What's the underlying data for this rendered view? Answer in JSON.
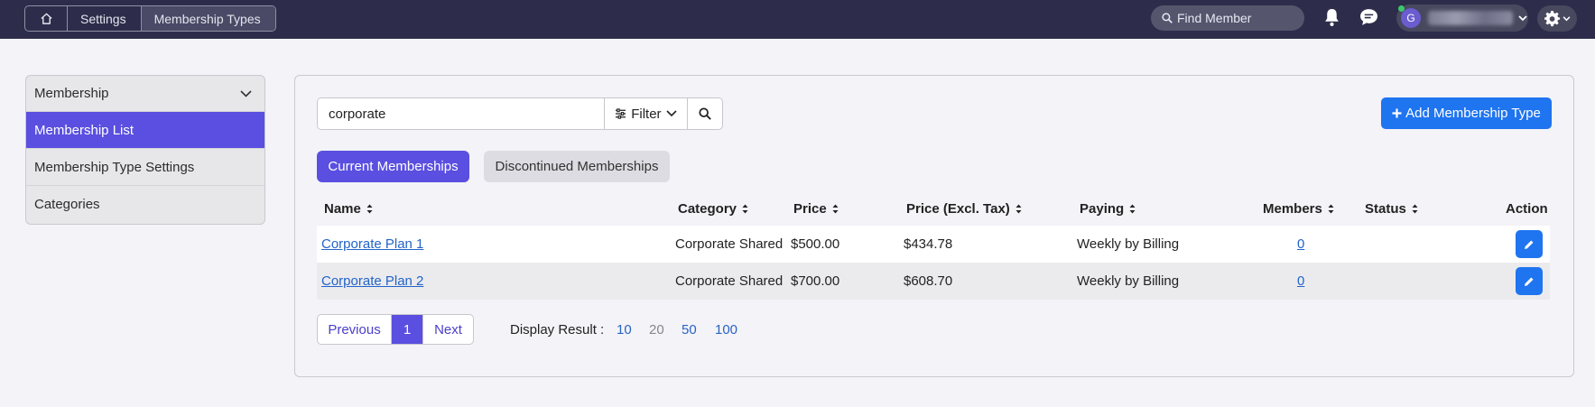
{
  "breadcrumb": {
    "items": [
      "Settings",
      "Membership Types"
    ]
  },
  "header": {
    "find_placeholder": "Find Member",
    "avatar_initial": "G"
  },
  "sidebar": {
    "section_title": "Membership",
    "items": [
      {
        "label": "Membership List",
        "active": true
      },
      {
        "label": "Membership Type Settings",
        "active": false
      },
      {
        "label": "Categories",
        "active": false
      }
    ]
  },
  "toolbar": {
    "search_value": "corporate",
    "filter_label": "Filter",
    "add_label": "Add Membership Type"
  },
  "tabs": {
    "current": "Current Memberships",
    "discontinued": "Discontinued Memberships"
  },
  "table": {
    "columns": [
      "Name",
      "Category",
      "Price",
      "Price (Excl. Tax)",
      "Paying",
      "Members",
      "Status",
      "Action"
    ],
    "rows": [
      {
        "name": "Corporate Plan 1",
        "category": "Corporate Shared",
        "price": "$500.00",
        "price_excl": "$434.78",
        "paying": "Weekly by Billing",
        "members": "0",
        "status": ""
      },
      {
        "name": "Corporate Plan 2",
        "category": "Corporate Shared",
        "price": "$700.00",
        "price_excl": "$608.70",
        "paying": "Weekly by Billing",
        "members": "0",
        "status": ""
      }
    ]
  },
  "pagination": {
    "previous": "Previous",
    "current_page": "1",
    "next": "Next",
    "display_label": "Display Result :",
    "options": [
      "10",
      "20",
      "50",
      "100"
    ],
    "selected": "20"
  },
  "colors": {
    "topbar": "#2d2d4b",
    "accent_purple": "#5a4fe0",
    "accent_blue": "#1f74f0",
    "link": "#2264c8"
  }
}
